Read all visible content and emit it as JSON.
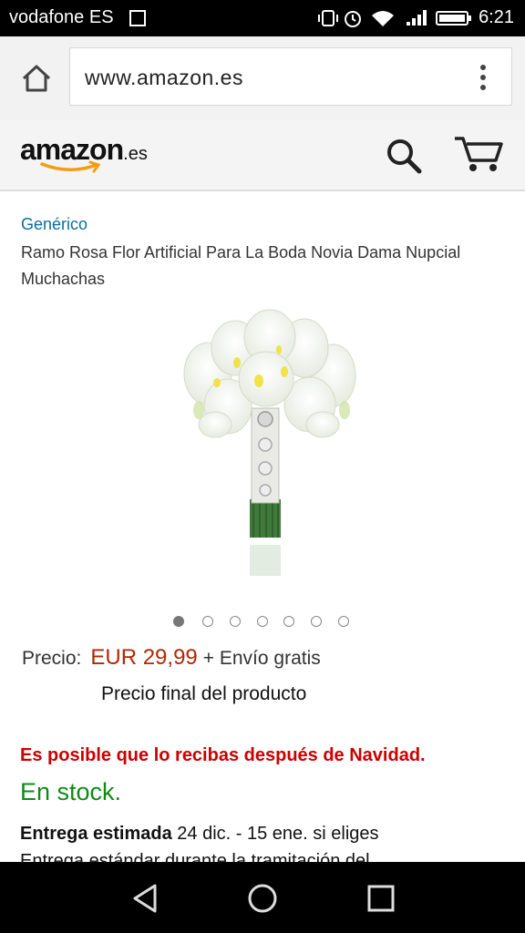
{
  "status": {
    "carrier": "vodafone ES",
    "time": "6:21"
  },
  "browser": {
    "url": "www.amazon.es"
  },
  "header": {
    "logo_text": "amazon",
    "logo_tld": ".es"
  },
  "product": {
    "brand": "Genérico",
    "title": "Ramo Rosa Flor Artificial Para La Boda Novia Dama Nupcial Muchachas",
    "image_count": 7,
    "active_image": 1,
    "price_label": "Precio:",
    "price": "EUR 29,99",
    "shipping": "+ Envío gratis",
    "final_price_note": "Precio final del producto",
    "delivery_warning": "Es posible que lo recibas después de Navidad.",
    "stock": "En stock.",
    "delivery_label": "Entrega estimada",
    "delivery_text": "24 dic. - 15 ene. si eliges",
    "delivery_text_2": "Entrega estándar durante la tramitación del"
  },
  "colors": {
    "price": "#b12704",
    "stock": "#118a15",
    "warning": "#cc0000",
    "brand_link": "#0a6e9e"
  },
  "icons": [
    "home-icon",
    "more-vert-icon",
    "search-icon",
    "cart-icon",
    "back-icon",
    "home-circle-icon",
    "recents-icon"
  ]
}
